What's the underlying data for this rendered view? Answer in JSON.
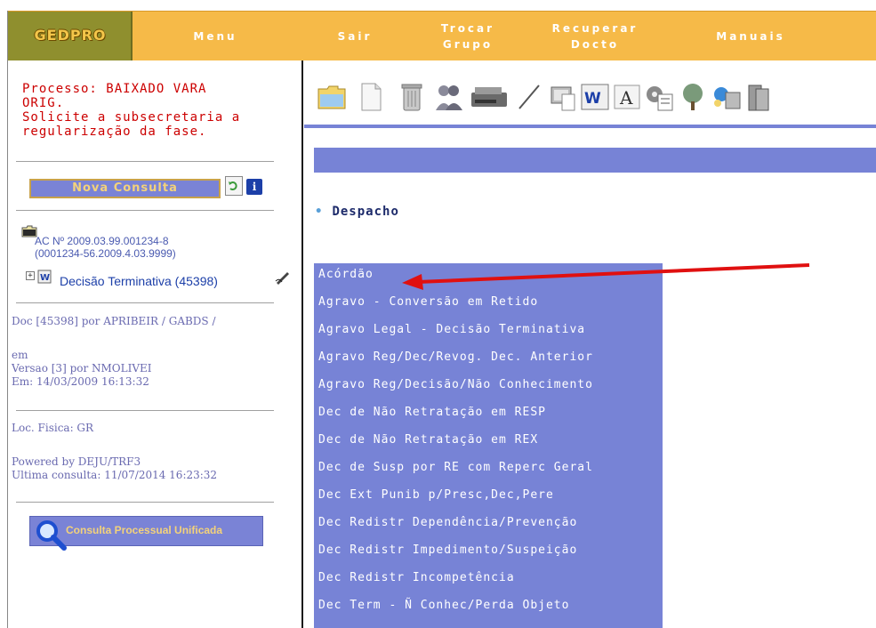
{
  "header": {
    "logo": "GEDPRO",
    "nav": [
      {
        "lines": [
          "Menu"
        ]
      },
      {
        "lines": [
          "Sair"
        ]
      },
      {
        "lines": [
          "Trocar",
          "Grupo"
        ]
      },
      {
        "lines": [
          "Recuperar",
          "Docto"
        ]
      },
      {
        "lines": [
          "Manuais"
        ]
      }
    ]
  },
  "sidebar": {
    "status_lines": [
      "Processo: BAIXADO VARA",
      "ORIG.",
      "Solicite a subsecretaria a",
      "regularização da fase."
    ],
    "new_query_label": "Nova Consulta",
    "case_number": "AC Nº 2009.03.99.001234-8",
    "case_cnj": "(0001234-56.2009.4.03.9999)",
    "doc_node_label": "Decisão Terminativa (45398)",
    "doc_info": "Doc [45398] por APRIBEIR / GABDS /",
    "em_label": "em",
    "version_line": "Versao [3] por NMOLIVEI",
    "em_date": "Em: 14/03/2009 16:13:32",
    "loc_fisica": "Loc. Fisica: GR",
    "powered_by": "Powered by DEJU/TRF3",
    "ultima_consulta": "Ultima consulta: 11/07/2014 16:23:32",
    "unified_search_label": "Consulta Processual Unificada"
  },
  "main": {
    "section_title": "Despacho",
    "menu_items": [
      "Acórdão",
      "Agravo - Conversão em Retido",
      "Agravo Legal - Decisão Terminativa",
      "Agravo Reg/Dec/Revog. Dec. Anterior",
      "Agravo Reg/Decisão/Não Conhecimento",
      "Dec de Não Retratação em RESP",
      "Dec de Não Retratação em REX",
      "Dec de Susp por RE com Reperc Geral",
      "Dec Ext Punib p/Presc,Dec,Pere",
      "Dec Redistr Dependência/Prevenção",
      "Dec Redistr Impedimento/Suspeição",
      "Dec Redistr Incompetência",
      "Dec Term - Ñ Conhec/Perda Objeto"
    ]
  },
  "colors": {
    "topbar": "#f6ba48",
    "menu_blue": "#7783d6",
    "status_red": "#cc0000",
    "annotation_arrow": "#e01010"
  },
  "toolbar_icons": [
    "folder-icon",
    "blank-page-icon",
    "trash-icon",
    "users-icon",
    "scanner-icon",
    "pen-icon",
    "computer-document-icon",
    "word-icon",
    "font-a-icon",
    "settings-list-icon",
    "tree-icon",
    "network-icon",
    "server-icon"
  ]
}
